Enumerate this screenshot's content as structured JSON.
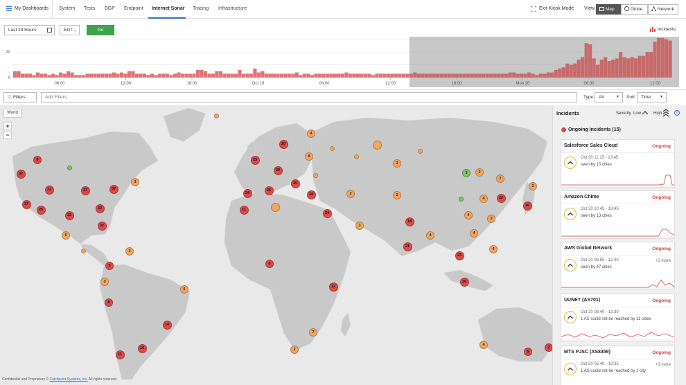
{
  "nav": {
    "dashboards": "My Dashboards",
    "tabs": [
      "System",
      "Tests",
      "BGP",
      "Endpoint",
      "Internet Sonar",
      "Tracing",
      "Infrastructure"
    ],
    "active_tab": "Internet Sonar",
    "exit_kiosk": "Exit Kiosk Mode",
    "view_label": "View",
    "views": [
      "Map",
      "Globe",
      "Network"
    ],
    "active_view": "Map"
  },
  "controls": {
    "time_range": "Last 24 Hours",
    "timezone": "EDT",
    "go": "Go",
    "incidents_toggle": "Incidents"
  },
  "chart_data": {
    "type": "bar",
    "y_ticks": [
      "20",
      "0"
    ],
    "ylim": [
      0,
      32
    ],
    "x_ticks": [
      "06:00",
      "12:00",
      "18:00",
      "Oct 19",
      "06:00",
      "12:00",
      "18:00",
      "Mon 20",
      "06:00",
      "12:00"
    ],
    "values": [
      5,
      5,
      3,
      3,
      3,
      2,
      4,
      3,
      3,
      2,
      3,
      2,
      4,
      3,
      5,
      4,
      2,
      2,
      2,
      3,
      3,
      3,
      3,
      3,
      3,
      3,
      4,
      3,
      4,
      3,
      5,
      5,
      3,
      3,
      3,
      2,
      3,
      2,
      3,
      3,
      3,
      2,
      3,
      4,
      3,
      3,
      3,
      3,
      6,
      6,
      5,
      3,
      3,
      5,
      5,
      3,
      3,
      3,
      3,
      6,
      3,
      3,
      3,
      7,
      4,
      5,
      3,
      3,
      3,
      3,
      3,
      3,
      3,
      3,
      4,
      2,
      3,
      3,
      2,
      3,
      3,
      3,
      3,
      3,
      3,
      3,
      3,
      4,
      3,
      3,
      3,
      3,
      3,
      3,
      2,
      3,
      3,
      3,
      3,
      3,
      3,
      3,
      3,
      3,
      3,
      4,
      3,
      3,
      3,
      3,
      3,
      3,
      3,
      3,
      3,
      3,
      3,
      3,
      3,
      3,
      3,
      3,
      3,
      3,
      3,
      3,
      3,
      3,
      3,
      3,
      4,
      4,
      3,
      3,
      3,
      4,
      3,
      2,
      3,
      3,
      4,
      4,
      6,
      7,
      8,
      11,
      10,
      11,
      14,
      16,
      27,
      26,
      15,
      10,
      14,
      16,
      13,
      14,
      15,
      20,
      16,
      15,
      16,
      15,
      17,
      17,
      20,
      20,
      28,
      31,
      31,
      30,
      29
    ],
    "selection_start_index": 104,
    "grid": true
  },
  "filters": {
    "button": "Filters",
    "placeholder": "Add Filters",
    "type_label": "Type",
    "type_value": "All",
    "sort_label": "Sort",
    "sort_value": "Time"
  },
  "map": {
    "world_btn": "World",
    "zoom_in": "+",
    "zoom_out": "−",
    "footer_prefix": "Confidential and Proprietary © ",
    "footer_link": "Catchpoint Systems, Inc.",
    "footer_suffix": " All rights reserved.",
    "clusters": [
      {
        "label": "32",
        "x": 30,
        "y": 251,
        "c": "red"
      },
      {
        "label": "8",
        "x": 54,
        "y": 231,
        "c": "red"
      },
      {
        "label": "",
        "x": 100,
        "y": 242,
        "c": "green"
      },
      {
        "label": "31",
        "x": 71,
        "y": 274,
        "c": "red"
      },
      {
        "label": "37",
        "x": 123,
        "y": 275,
        "c": "red"
      },
      {
        "label": "37",
        "x": 164,
        "y": 273,
        "c": "red"
      },
      {
        "label": "3",
        "x": 195,
        "y": 263,
        "c": "orange"
      },
      {
        "label": "37",
        "x": 38,
        "y": 295,
        "c": "red"
      },
      {
        "label": "25",
        "x": 59,
        "y": 303,
        "c": "red"
      },
      {
        "label": "32",
        "x": 100,
        "y": 311,
        "c": "red"
      },
      {
        "label": "32",
        "x": 144,
        "y": 301,
        "c": "red"
      },
      {
        "label": "32",
        "x": 147,
        "y": 326,
        "c": "red"
      },
      {
        "label": "6",
        "x": 95,
        "y": 340,
        "c": "orange"
      },
      {
        "label": "",
        "x": 120,
        "y": 362,
        "c": "orange"
      },
      {
        "label": "3",
        "x": 187,
        "y": 363,
        "c": "orange"
      },
      {
        "label": "5",
        "x": 158,
        "y": 384,
        "c": "red"
      },
      {
        "label": "3",
        "x": 151,
        "y": 407,
        "c": "orange"
      },
      {
        "label": "8",
        "x": 157,
        "y": 437,
        "c": "red"
      },
      {
        "label": "6",
        "x": 266,
        "y": 418,
        "c": "orange"
      },
      {
        "label": "14",
        "x": 241,
        "y": 469,
        "c": "red"
      },
      {
        "label": "14",
        "x": 205,
        "y": 503,
        "c": "red"
      },
      {
        "label": "11",
        "x": 173,
        "y": 512,
        "c": "red"
      },
      {
        "label": "",
        "x": 312,
        "y": 167,
        "c": "orange"
      },
      {
        "label": "20",
        "x": 409,
        "y": 208,
        "c": "red"
      },
      {
        "label": "4",
        "x": 449,
        "y": 193,
        "c": "orange"
      },
      {
        "label": "",
        "x": 479,
        "y": 214,
        "c": "orange"
      },
      {
        "label": "",
        "x": 544,
        "y": 209,
        "c": "orange"
      },
      {
        "label": "",
        "x": 606,
        "y": 218,
        "c": "orange"
      },
      {
        "label": "8",
        "x": 446,
        "y": 226,
        "c": "orange"
      },
      {
        "label": "",
        "x": 514,
        "y": 226,
        "c": "orange"
      },
      {
        "label": "23",
        "x": 368,
        "y": 231,
        "c": "red"
      },
      {
        "label": "29",
        "x": 401,
        "y": 246,
        "c": "red"
      },
      {
        "label": "3",
        "x": 573,
        "y": 236,
        "c": "orange"
      },
      {
        "label": "",
        "x": 455,
        "y": 253,
        "c": "orange"
      },
      {
        "label": "3",
        "x": 673,
        "y": 250,
        "c": "green"
      },
      {
        "label": "2",
        "x": 692,
        "y": 249,
        "c": "orange"
      },
      {
        "label": "2",
        "x": 722,
        "y": 258,
        "c": "orange"
      },
      {
        "label": "25",
        "x": 426,
        "y": 265,
        "c": "red"
      },
      {
        "label": "26",
        "x": 388,
        "y": 275,
        "c": "red"
      },
      {
        "label": "24",
        "x": 357,
        "y": 279,
        "c": "red"
      },
      {
        "label": "24",
        "x": 449,
        "y": 281,
        "c": "red"
      },
      {
        "label": "2",
        "x": 506,
        "y": 280,
        "c": "orange"
      },
      {
        "label": "2",
        "x": 573,
        "y": 282,
        "c": "orange"
      },
      {
        "label": "2",
        "x": 769,
        "y": 269,
        "c": "orange"
      },
      {
        "label": "22",
        "x": 723,
        "y": 286,
        "c": "red"
      },
      {
        "label": "",
        "x": 665,
        "y": 287,
        "c": "green"
      },
      {
        "label": "",
        "x": 397,
        "y": 299,
        "c": "orange"
      },
      {
        "label": "11",
        "x": 352,
        "y": 303,
        "c": "red"
      },
      {
        "label": "4",
        "x": 698,
        "y": 287,
        "c": "orange"
      },
      {
        "label": "16",
        "x": 761,
        "y": 297,
        "c": "red"
      },
      {
        "label": "24",
        "x": 472,
        "y": 308,
        "c": "red"
      },
      {
        "label": "4",
        "x": 676,
        "y": 311,
        "c": "orange"
      },
      {
        "label": "3",
        "x": 709,
        "y": 316,
        "c": "orange"
      },
      {
        "label": "3",
        "x": 519,
        "y": 326,
        "c": "orange"
      },
      {
        "label": "18",
        "x": 591,
        "y": 320,
        "c": "red"
      },
      {
        "label": "4",
        "x": 684,
        "y": 337,
        "c": "orange"
      },
      {
        "label": "4",
        "x": 621,
        "y": 340,
        "c": "orange"
      },
      {
        "label": "21",
        "x": 588,
        "y": 356,
        "c": "red"
      },
      {
        "label": "4",
        "x": 712,
        "y": 360,
        "c": "orange"
      },
      {
        "label": "23",
        "x": 663,
        "y": 369,
        "c": "red"
      },
      {
        "label": "6",
        "x": 389,
        "y": 381,
        "c": "red"
      },
      {
        "label": "26",
        "x": 670,
        "y": 407,
        "c": "red"
      },
      {
        "label": "12",
        "x": 481,
        "y": 414,
        "c": "red"
      },
      {
        "label": "7",
        "x": 452,
        "y": 480,
        "c": "orange"
      },
      {
        "label": "2",
        "x": 425,
        "y": 505,
        "c": "orange"
      },
      {
        "label": "4",
        "x": 698,
        "y": 498,
        "c": "orange"
      },
      {
        "label": "5",
        "x": 762,
        "y": 508,
        "c": "red"
      },
      {
        "label": "2",
        "x": 792,
        "y": 502,
        "c": "red"
      }
    ]
  },
  "panel": {
    "title": "Incidents",
    "severity_label": "Severity",
    "severity_low": "Low",
    "severity_high": "High",
    "ongoing_header": "Ongoing Incidents (15)",
    "cards": [
      {
        "title": "Salesforce Sales Cloud",
        "status": "Ongoing",
        "time": "Oct 20 11:15 - 13:45",
        "desc": "seen by 15 cities",
        "more": ""
      },
      {
        "title": "Amazon Chime",
        "status": "Ongoing",
        "time": "Oct 20 10:45 - 13:45",
        "desc": "seen by 13 cities",
        "more": ""
      },
      {
        "title": "AWS Global Network",
        "status": "Ongoing",
        "time": "Oct 20 08:55 - 12:40",
        "desc": "seen by 47 cities",
        "more": "+2 more"
      },
      {
        "title": "UUNET (AS701)",
        "status": "Ongoing",
        "time": "Oct 20 08:40 - 13:30",
        "desc": "1 AS could not be reached by 11 cities",
        "more": ""
      },
      {
        "title": "MTS PJSC (AS8359)",
        "status": "Ongoing",
        "time": "Oct 20 05:40 - 13:35",
        "desc": "1 AS could not be reached by 1 city",
        "more": "+3 more"
      }
    ]
  }
}
